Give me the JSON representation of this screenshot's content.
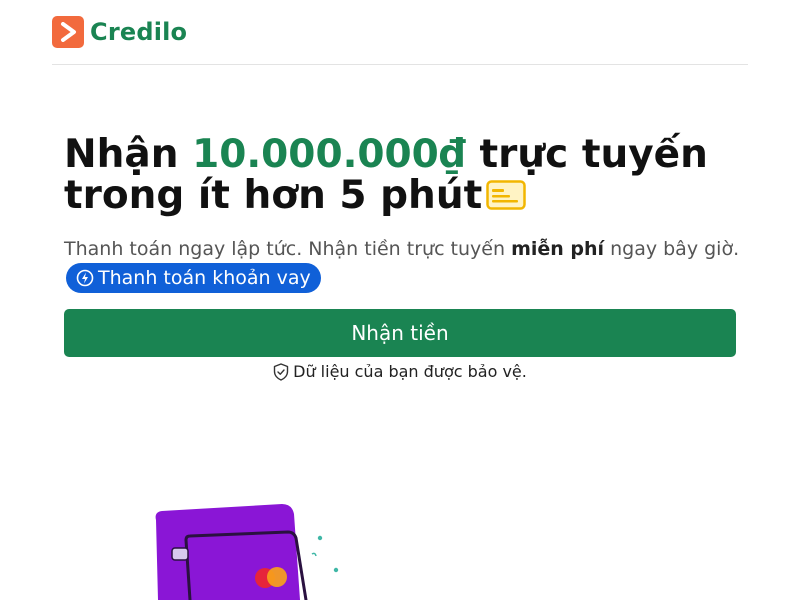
{
  "brand": {
    "name": "Credilo",
    "logo_color": "#f26a3d",
    "brand_color": "#1a8452"
  },
  "hero": {
    "title_pre": "Nhận ",
    "title_amount": "10.000.000₫",
    "title_post": " trực tuyến trong ít hơn 5 phút",
    "emoji_icon": "credit-card-icon",
    "subtitle_pre": "Thanh toán ngay lập tức. Nhận tiền trực tuyến ",
    "subtitle_bold": "miễn phí",
    "subtitle_post": " ngay bây giờ.",
    "pill_label": "Thanh toán khoản vay",
    "pill_color": "#1060d8"
  },
  "cta": {
    "label": "Nhận tiền"
  },
  "secure": {
    "label": "Dữ liệu của bạn được bảo vệ."
  }
}
